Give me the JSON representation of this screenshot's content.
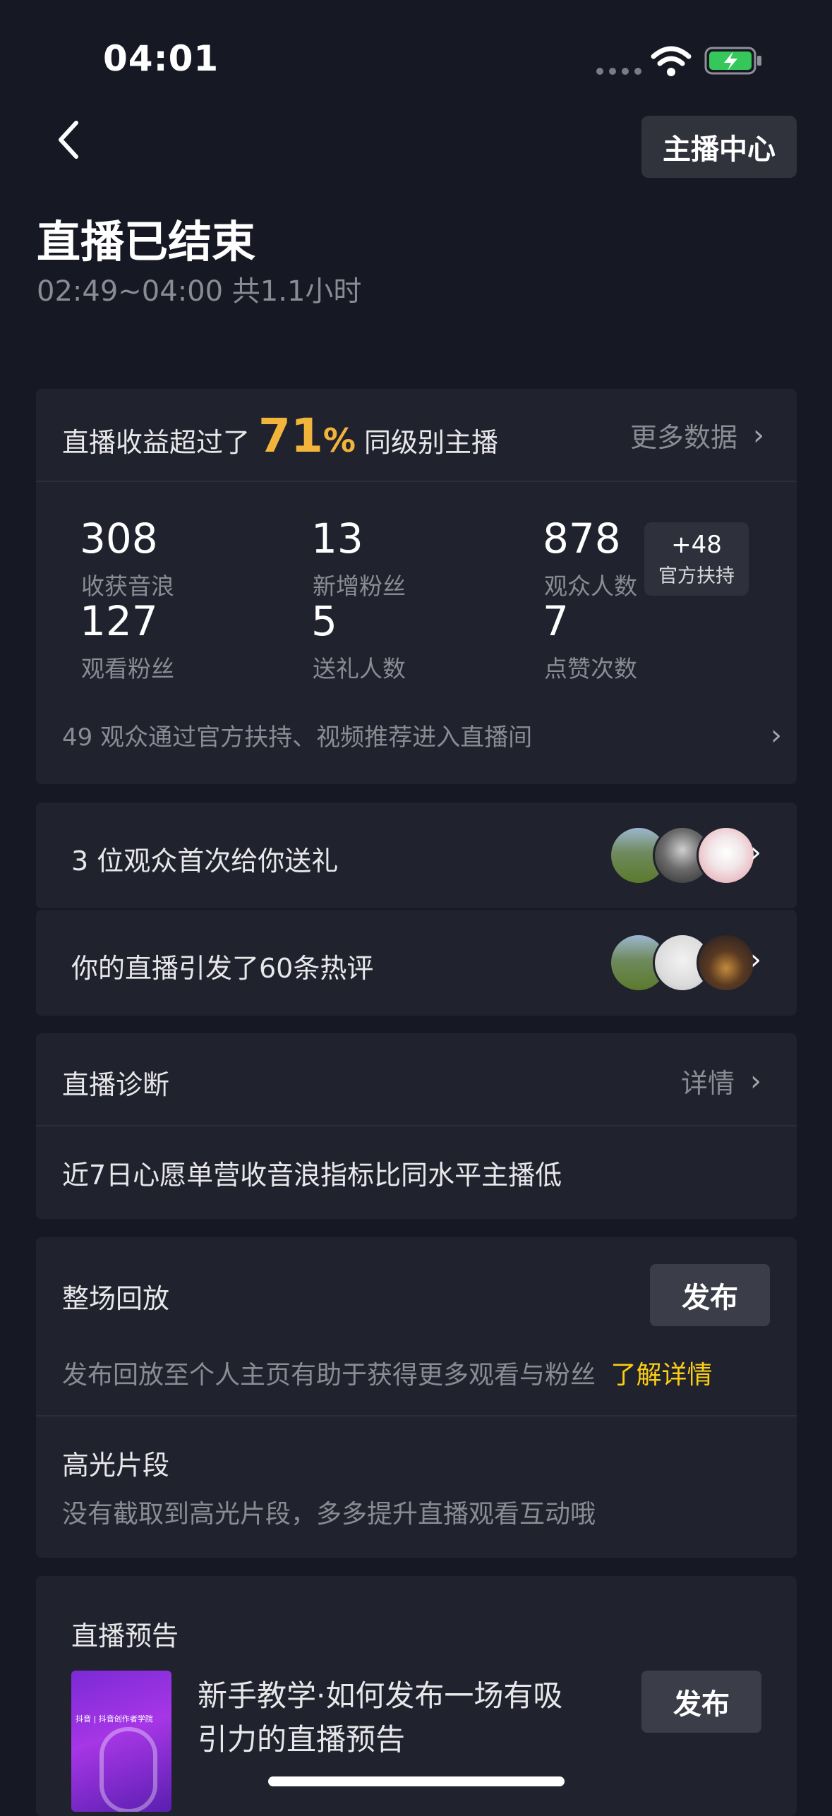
{
  "status_bar": {
    "time": "04:01"
  },
  "header": {
    "host_center_label": "主播中心",
    "title": "直播已结束",
    "subtitle": "02:49~04:00 共1.1小时"
  },
  "summary": {
    "prefix": "直播收益超过了",
    "percent": "71",
    "percent_sign": "%",
    "suffix": "同级别主播",
    "more_link": "更多数据",
    "stats": [
      {
        "value": "308",
        "label": "收获音浪"
      },
      {
        "value": "13",
        "label": "新增粉丝"
      },
      {
        "value": "878",
        "label": "观众人数"
      },
      {
        "value": "127",
        "label": "观看粉丝"
      },
      {
        "value": "5",
        "label": "送礼人数"
      },
      {
        "value": "7",
        "label": "点赞次数"
      }
    ],
    "boost_badge": {
      "value": "+48",
      "label": "官方扶持"
    },
    "source_note": "49 观众通过官方扶持、视频推荐进入直播间"
  },
  "gift_row": {
    "text": "3 位观众首次给你送礼"
  },
  "comment_row": {
    "text": "你的直播引发了60条热评"
  },
  "diagnosis": {
    "title": "直播诊断",
    "detail_link": "详情",
    "message": "近7日心愿单营收音浪指标比同水平主播低"
  },
  "replay": {
    "title": "整场回放",
    "publish_label": "发布",
    "description": "发布回放至个人主页有助于获得更多观看与粉丝",
    "learn_more": "了解详情",
    "highlight_title": "高光片段",
    "highlight_desc": "没有截取到高光片段，多多提升直播观看互动哦"
  },
  "preview": {
    "title": "直播预告",
    "thumb_caption": "抖音 | 抖音创作者学院",
    "line1": "新手教学·如何发布一场有吸",
    "line2": "引力的直播预告",
    "publish_label": "发布"
  },
  "colors": {
    "accent_gold": "#f2b43a",
    "link_yellow": "#face15",
    "background": "#161823",
    "card": "#20222d"
  }
}
